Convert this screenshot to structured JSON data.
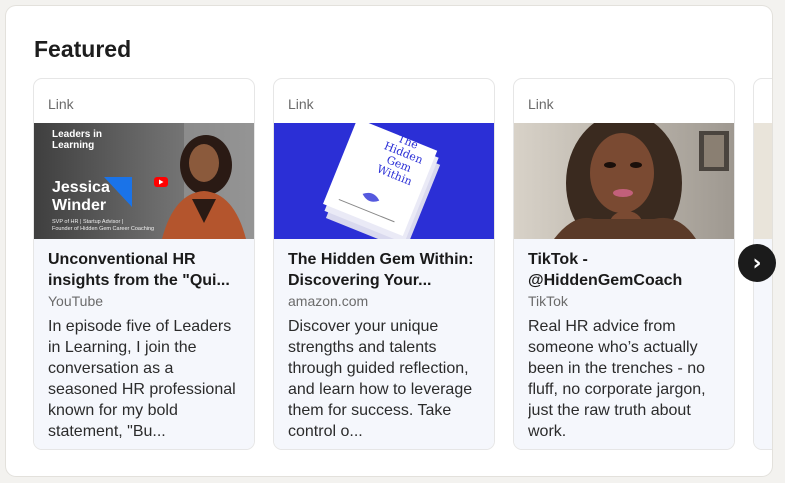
{
  "section": {
    "title": "Featured"
  },
  "cards": [
    {
      "kind": "Link",
      "title": "Unconventional HR insights from the \"Qui...",
      "source": "YouTube",
      "description": "In episode five of Leaders in Learning, I join the conversation as a seasoned HR professional known for my bold statement, \"Bu...",
      "thumb": {
        "brand_line1": "Leaders in",
        "brand_line2": "Learning",
        "name_first": "Jessica",
        "name_last": "Winder",
        "caption1": "SVP of HR | Startup Advisor |",
        "caption2": "Founder of Hidden Gem Career Coaching"
      }
    },
    {
      "kind": "Link",
      "title": "The Hidden Gem Within: Discovering Your...",
      "source": "amazon.com",
      "description": "Discover your unique strengths and talents through guided reflection, and learn how to leverage them for success. Take control o...",
      "thumb": {
        "book_line1": "The",
        "book_line2": "Hidden",
        "book_line3": "Gem",
        "book_line4": "Within"
      }
    },
    {
      "kind": "Link",
      "title": "TikTok - @HiddenGemCoach",
      "source": "TikTok",
      "description": "Real HR advice from someone who’s actually been in the trenches - no fluff, no corporate jargon, just the raw truth about work."
    }
  ],
  "next_button": {
    "label": "›"
  },
  "colors": {
    "book_bg": "#2b2fd6",
    "youtube_red": "#ff0000",
    "card_body": "#f5f7fc"
  }
}
